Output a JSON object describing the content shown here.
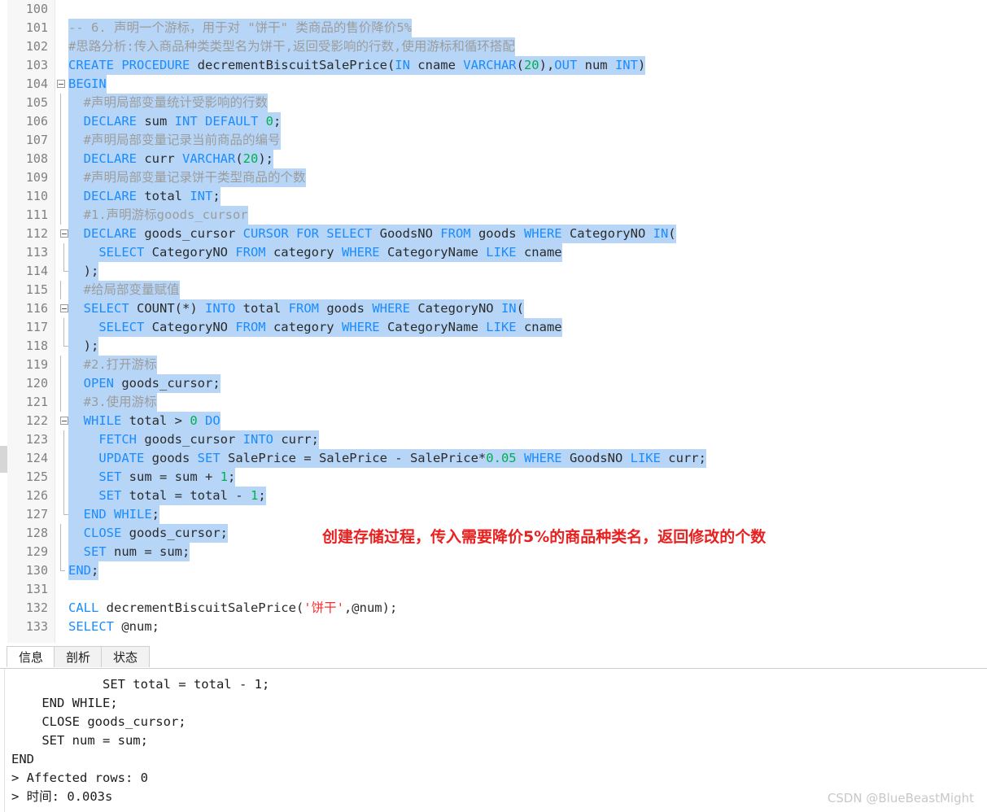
{
  "editor": {
    "first_line": 100,
    "lines": [
      {
        "num": "100",
        "fold": "none",
        "selected": false,
        "segments": []
      },
      {
        "num": "101",
        "fold": "none",
        "selected": true,
        "segments": [
          {
            "t": "-- 6. 声明一个游标，用于对 \"饼干\" 类商品的售价降价5%",
            "c": "cmt"
          }
        ]
      },
      {
        "num": "102",
        "fold": "none",
        "selected": true,
        "segments": [
          {
            "t": "#思路分析:传入商品种类类型名为饼干,返回受影响的行数,使用游标和循环搭配",
            "c": "cmt"
          }
        ]
      },
      {
        "num": "103",
        "fold": "none",
        "selected": true,
        "segments": [
          {
            "t": "CREATE PROCEDURE ",
            "c": "kw"
          },
          {
            "t": "decrementBiscuitSalePrice",
            "c": "id"
          },
          {
            "t": "(",
            "c": "pl"
          },
          {
            "t": "IN",
            "c": "kw"
          },
          {
            "t": " cname ",
            "c": "id"
          },
          {
            "t": "VARCHAR",
            "c": "kw"
          },
          {
            "t": "(",
            "c": "pl"
          },
          {
            "t": "20",
            "c": "num"
          },
          {
            "t": "),",
            "c": "pl"
          },
          {
            "t": "OUT",
            "c": "kw"
          },
          {
            "t": " num ",
            "c": "id"
          },
          {
            "t": "INT",
            "c": "kw"
          },
          {
            "t": ")",
            "c": "pl"
          }
        ]
      },
      {
        "num": "104",
        "fold": "open",
        "selected": true,
        "segments": [
          {
            "t": "BEGIN",
            "c": "kw"
          }
        ]
      },
      {
        "num": "105",
        "fold": "bar",
        "selected": true,
        "segments": [
          {
            "t": "  #声明局部变量统计受影响的行数",
            "c": "cmt"
          }
        ]
      },
      {
        "num": "106",
        "fold": "bar",
        "selected": true,
        "segments": [
          {
            "t": "  ",
            "c": "pl"
          },
          {
            "t": "DECLARE",
            "c": "kw"
          },
          {
            "t": " sum ",
            "c": "id"
          },
          {
            "t": "INT DEFAULT",
            "c": "kw"
          },
          {
            "t": " ",
            "c": "pl"
          },
          {
            "t": "0",
            "c": "num"
          },
          {
            "t": ";",
            "c": "pl"
          }
        ]
      },
      {
        "num": "107",
        "fold": "bar",
        "selected": true,
        "segments": [
          {
            "t": "  #声明局部变量记录当前商品的编号",
            "c": "cmt"
          }
        ]
      },
      {
        "num": "108",
        "fold": "bar",
        "selected": true,
        "segments": [
          {
            "t": "  ",
            "c": "pl"
          },
          {
            "t": "DECLARE",
            "c": "kw"
          },
          {
            "t": " curr ",
            "c": "id"
          },
          {
            "t": "VARCHAR",
            "c": "kw"
          },
          {
            "t": "(",
            "c": "pl"
          },
          {
            "t": "20",
            "c": "num"
          },
          {
            "t": ");",
            "c": "pl"
          }
        ]
      },
      {
        "num": "109",
        "fold": "bar",
        "selected": true,
        "segments": [
          {
            "t": "  #声明局部变量记录饼干类型商品的个数",
            "c": "cmt"
          }
        ]
      },
      {
        "num": "110",
        "fold": "bar",
        "selected": true,
        "segments": [
          {
            "t": "  ",
            "c": "pl"
          },
          {
            "t": "DECLARE",
            "c": "kw"
          },
          {
            "t": " total ",
            "c": "id"
          },
          {
            "t": "INT",
            "c": "kw"
          },
          {
            "t": ";",
            "c": "pl"
          }
        ]
      },
      {
        "num": "111",
        "fold": "bar",
        "selected": true,
        "segments": [
          {
            "t": "  #1.声明游标goods_cursor",
            "c": "cmt"
          }
        ]
      },
      {
        "num": "112",
        "fold": "open2",
        "selected": true,
        "segments": [
          {
            "t": "  ",
            "c": "pl"
          },
          {
            "t": "DECLARE",
            "c": "kw"
          },
          {
            "t": " goods_cursor ",
            "c": "id"
          },
          {
            "t": "CURSOR FOR SELECT",
            "c": "kw"
          },
          {
            "t": " GoodsNO ",
            "c": "id"
          },
          {
            "t": "FROM",
            "c": "kw"
          },
          {
            "t": " goods ",
            "c": "id"
          },
          {
            "t": "WHERE",
            "c": "kw"
          },
          {
            "t": " CategoryNO ",
            "c": "id"
          },
          {
            "t": "IN",
            "c": "kw"
          },
          {
            "t": "(",
            "c": "pl"
          }
        ]
      },
      {
        "num": "113",
        "fold": "bar2",
        "selected": true,
        "segments": [
          {
            "t": "    ",
            "c": "pl"
          },
          {
            "t": "SELECT",
            "c": "kw"
          },
          {
            "t": " CategoryNO ",
            "c": "id"
          },
          {
            "t": "FROM",
            "c": "kw"
          },
          {
            "t": " category ",
            "c": "id"
          },
          {
            "t": "WHERE",
            "c": "kw"
          },
          {
            "t": " CategoryName ",
            "c": "id"
          },
          {
            "t": "LIKE",
            "c": "kw"
          },
          {
            "t": " cname",
            "c": "id"
          }
        ]
      },
      {
        "num": "114",
        "fold": "close2",
        "selected": true,
        "segments": [
          {
            "t": "  );",
            "c": "pl"
          }
        ]
      },
      {
        "num": "115",
        "fold": "bar",
        "selected": true,
        "segments": [
          {
            "t": "  #给局部变量赋值",
            "c": "cmt"
          }
        ]
      },
      {
        "num": "116",
        "fold": "open2",
        "selected": true,
        "segments": [
          {
            "t": "  ",
            "c": "pl"
          },
          {
            "t": "SELECT",
            "c": "kw"
          },
          {
            "t": " COUNT(*) ",
            "c": "id"
          },
          {
            "t": "INTO",
            "c": "kw"
          },
          {
            "t": " total ",
            "c": "id"
          },
          {
            "t": "FROM",
            "c": "kw"
          },
          {
            "t": " goods ",
            "c": "id"
          },
          {
            "t": "WHERE",
            "c": "kw"
          },
          {
            "t": " CategoryNO ",
            "c": "id"
          },
          {
            "t": "IN",
            "c": "kw"
          },
          {
            "t": "(",
            "c": "pl"
          }
        ]
      },
      {
        "num": "117",
        "fold": "bar2",
        "selected": true,
        "segments": [
          {
            "t": "    ",
            "c": "pl"
          },
          {
            "t": "SELECT",
            "c": "kw"
          },
          {
            "t": " CategoryNO ",
            "c": "id"
          },
          {
            "t": "FROM",
            "c": "kw"
          },
          {
            "t": " category ",
            "c": "id"
          },
          {
            "t": "WHERE",
            "c": "kw"
          },
          {
            "t": " CategoryName ",
            "c": "id"
          },
          {
            "t": "LIKE",
            "c": "kw"
          },
          {
            "t": " cname",
            "c": "id"
          }
        ]
      },
      {
        "num": "118",
        "fold": "close2",
        "selected": true,
        "segments": [
          {
            "t": "  );",
            "c": "pl"
          }
        ]
      },
      {
        "num": "119",
        "fold": "bar",
        "selected": true,
        "segments": [
          {
            "t": "  #2.打开游标",
            "c": "cmt"
          }
        ]
      },
      {
        "num": "120",
        "fold": "bar",
        "selected": true,
        "segments": [
          {
            "t": "  ",
            "c": "pl"
          },
          {
            "t": "OPEN",
            "c": "kw"
          },
          {
            "t": " goods_cursor;",
            "c": "id"
          }
        ]
      },
      {
        "num": "121",
        "fold": "bar",
        "selected": true,
        "segments": [
          {
            "t": "  #3.使用游标",
            "c": "cmt"
          }
        ]
      },
      {
        "num": "122",
        "fold": "open2",
        "selected": true,
        "segments": [
          {
            "t": "  ",
            "c": "pl"
          },
          {
            "t": "WHILE",
            "c": "kw"
          },
          {
            "t": " total > ",
            "c": "id"
          },
          {
            "t": "0",
            "c": "num"
          },
          {
            "t": " ",
            "c": "pl"
          },
          {
            "t": "DO",
            "c": "kw"
          }
        ]
      },
      {
        "num": "123",
        "fold": "bar2",
        "selected": true,
        "segments": [
          {
            "t": "    ",
            "c": "pl"
          },
          {
            "t": "FETCH",
            "c": "kw"
          },
          {
            "t": " goods_cursor ",
            "c": "id"
          },
          {
            "t": "INTO",
            "c": "kw"
          },
          {
            "t": " curr;",
            "c": "id"
          }
        ]
      },
      {
        "num": "124",
        "fold": "bar2",
        "selected": true,
        "segments": [
          {
            "t": "    ",
            "c": "pl"
          },
          {
            "t": "UPDATE",
            "c": "kw"
          },
          {
            "t": " goods ",
            "c": "id"
          },
          {
            "t": "SET",
            "c": "kw"
          },
          {
            "t": " SalePrice = SalePrice - SalePrice*",
            "c": "id"
          },
          {
            "t": "0.05",
            "c": "num"
          },
          {
            "t": " ",
            "c": "pl"
          },
          {
            "t": "WHERE",
            "c": "kw"
          },
          {
            "t": " GoodsNO ",
            "c": "id"
          },
          {
            "t": "LIKE",
            "c": "kw"
          },
          {
            "t": " curr;",
            "c": "id"
          }
        ]
      },
      {
        "num": "125",
        "fold": "bar2",
        "selected": true,
        "segments": [
          {
            "t": "    ",
            "c": "pl"
          },
          {
            "t": "SET",
            "c": "kw"
          },
          {
            "t": " sum = sum + ",
            "c": "id"
          },
          {
            "t": "1",
            "c": "num"
          },
          {
            "t": ";",
            "c": "pl"
          }
        ]
      },
      {
        "num": "126",
        "fold": "bar2",
        "selected": true,
        "segments": [
          {
            "t": "    ",
            "c": "pl"
          },
          {
            "t": "SET",
            "c": "kw"
          },
          {
            "t": " total = total - ",
            "c": "id"
          },
          {
            "t": "1",
            "c": "num"
          },
          {
            "t": ";",
            "c": "pl"
          }
        ]
      },
      {
        "num": "127",
        "fold": "close2",
        "selected": true,
        "segments": [
          {
            "t": "  ",
            "c": "pl"
          },
          {
            "t": "END WHILE",
            "c": "kw"
          },
          {
            "t": ";",
            "c": "pl"
          }
        ]
      },
      {
        "num": "128",
        "fold": "bar",
        "selected": true,
        "segments": [
          {
            "t": "  ",
            "c": "pl"
          },
          {
            "t": "CLOSE",
            "c": "kw"
          },
          {
            "t": " goods_cursor;",
            "c": "id"
          }
        ]
      },
      {
        "num": "129",
        "fold": "bar",
        "selected": true,
        "segments": [
          {
            "t": "  ",
            "c": "pl"
          },
          {
            "t": "SET",
            "c": "kw"
          },
          {
            "t": " num = sum;",
            "c": "id"
          }
        ]
      },
      {
        "num": "130",
        "fold": "close",
        "selected": true,
        "segments": [
          {
            "t": "END",
            "c": "kw"
          },
          {
            "t": ";",
            "c": "pl"
          }
        ]
      },
      {
        "num": "131",
        "fold": "none",
        "selected": false,
        "segments": []
      },
      {
        "num": "132",
        "fold": "none",
        "selected": false,
        "segments": [
          {
            "t": "CALL",
            "c": "kw"
          },
          {
            "t": " decrementBiscuitSalePrice(",
            "c": "id"
          },
          {
            "t": "'饼干'",
            "c": "str"
          },
          {
            "t": ",@num);",
            "c": "id"
          }
        ]
      },
      {
        "num": "133",
        "fold": "none",
        "selected": false,
        "segments": [
          {
            "t": "SELECT",
            "c": "kw"
          },
          {
            "t": " @num;",
            "c": "id"
          }
        ]
      }
    ],
    "annotation": "创建存储过程，传入需要降价5%的商品种类名，返回修改的个数",
    "annotation_color": "#e8201f",
    "selection_color": "#b7d6f7",
    "keyword_color": "#1a8cff",
    "number_color": "#00b050",
    "comment_color": "#9c9c9c",
    "string_color": "#ff2d2d"
  },
  "bottom_panel": {
    "tabs": [
      {
        "label": "信息",
        "active": true
      },
      {
        "label": "剖析",
        "active": false
      },
      {
        "label": "状态",
        "active": false
      }
    ],
    "output": "            SET total = total - 1;\n    END WHILE;\n    CLOSE goods_cursor;\n    SET num = sum;\nEND\n> Affected rows: 0\n> 时间: 0.003s"
  },
  "watermark": "CSDN @BlueBeastMight"
}
